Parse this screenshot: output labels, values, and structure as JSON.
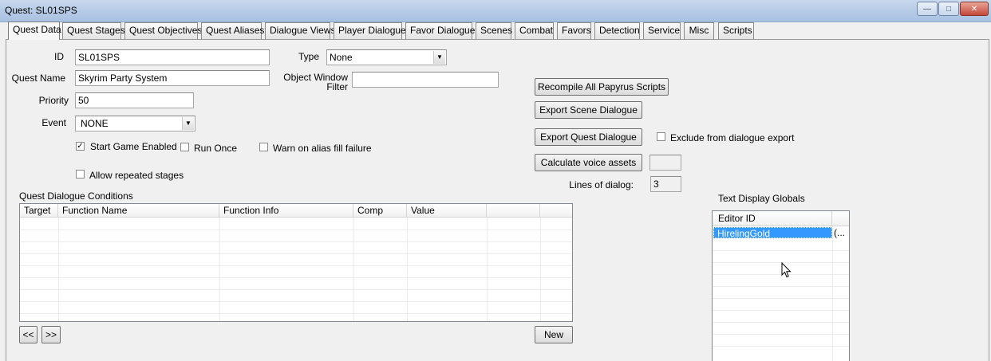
{
  "window": {
    "title": "Quest: SL01SPS",
    "minimize_glyph": "—",
    "maximize_glyph": "□",
    "close_glyph": "✕"
  },
  "tabs": [
    {
      "label": "Quest Data",
      "active": true
    },
    {
      "label": "Quest Stages"
    },
    {
      "label": "Quest Objectives"
    },
    {
      "label": "Quest Aliases"
    },
    {
      "label": "Dialogue Views"
    },
    {
      "label": "Player Dialogue"
    },
    {
      "label": "Favor Dialogue"
    },
    {
      "label": "Scenes"
    },
    {
      "label": "Combat"
    },
    {
      "label": "Favors"
    },
    {
      "label": "Detection"
    },
    {
      "label": "Service"
    },
    {
      "label": "Misc"
    },
    {
      "label": "Scripts"
    }
  ],
  "form": {
    "id_label": "ID",
    "id_value": "SL01SPS",
    "type_label": "Type",
    "type_value": "None",
    "quest_name_label": "Quest Name",
    "quest_name_value": "Skyrim Party System",
    "owf_label_1": "Object Window",
    "owf_label_2": "Filter",
    "owf_value": "",
    "priority_label": "Priority",
    "priority_value": "50",
    "event_label": "Event",
    "event_value": "NONE",
    "start_game_enabled_label": "Start Game Enabled",
    "start_game_enabled_checked": true,
    "run_once_label": "Run Once",
    "run_once_checked": false,
    "warn_alias_label": "Warn on alias fill failure",
    "warn_alias_checked": false,
    "allow_repeated_label": "Allow repeated stages",
    "allow_repeated_checked": false,
    "check_glyph": "✓"
  },
  "actions": {
    "recompile_label": "Recompile All Papyrus Scripts",
    "export_scene_label": "Export Scene Dialogue",
    "export_quest_label": "Export Quest Dialogue",
    "exclude_export_label": "Exclude from dialogue export",
    "exclude_export_checked": false,
    "calc_voice_label": "Calculate voice assets",
    "calc_voice_value": "",
    "lines_of_dialog_label": "Lines of dialog:",
    "lines_of_dialog_value": "3"
  },
  "conditions": {
    "label": "Quest Dialogue Conditions",
    "columns": [
      "Target",
      "Function Name",
      "Function Info",
      "Comp",
      "Value",
      ""
    ],
    "rows": [],
    "prev_label": "<<",
    "next_label": ">>",
    "new_label": "New"
  },
  "globals": {
    "label": "Text Display Globals",
    "columns": [
      "Editor ID",
      ""
    ],
    "rows": [
      {
        "editor_id": "HirelingGold",
        "extra": "(..."
      }
    ]
  },
  "colors": {
    "selection": "#3399ff",
    "titlebar": "#b6cbe6",
    "close_button": "#c4483a"
  }
}
